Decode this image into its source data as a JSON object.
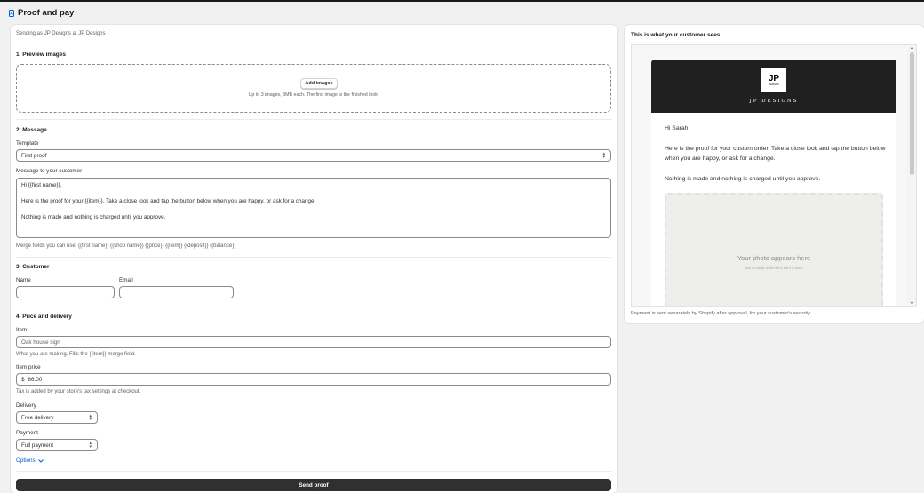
{
  "page": {
    "title": "Proof and pay"
  },
  "sender": {
    "text": "Sending as JP Designs at JP Designs"
  },
  "preview_images": {
    "heading": "1. Preview images",
    "add_label": "Add images",
    "help": "Up to 3 images, 8MB each. The first image is the finished look."
  },
  "message": {
    "heading": "2. Message",
    "template_label": "Template",
    "template_value": "First proof",
    "message_label": "Message to your customer",
    "lines": [
      "Hi {{first name}},",
      "Here is the proof for your {{item}}. Take a close look and tap the button below when you are happy, or ask for a change.",
      "Nothing is made and nothing is charged until you approve."
    ],
    "merge_help": "Merge fields you can use: {{first name}} {{shop name}} {{price}} {{item}} {{deposit}} {{balance}}"
  },
  "customer": {
    "heading": "3. Customer",
    "name_label": "Name",
    "name_value": "",
    "email_label": "Email",
    "email_value": ""
  },
  "price": {
    "heading": "4. Price and delivery",
    "item_label": "Item",
    "item_placeholder": "Oak house sign",
    "item_help": "What you are making. Fills the {{item}} merge field.",
    "price_label": "Item price",
    "currency": "$",
    "price_value": "86.00",
    "price_help": "Tax is added by your store's tax settings at checkout.",
    "delivery_label": "Delivery",
    "delivery_value": "Free delivery",
    "payment_label": "Payment",
    "payment_value": "Full payment",
    "options_label": "Options",
    "send_label": "Send proof"
  },
  "preview": {
    "heading": "This is what your customer sees",
    "logo_text": "JP",
    "logo_sub": "DESIGNS",
    "brand": "JP DESIGNS",
    "greeting": "Hi Sarah,",
    "body1": "Here is the proof for your custom order. Take a close look and tap the button below when you are happy, or ask for a change.",
    "body2": "Nothing is made and nothing is charged until you approve.",
    "photo_title": "Your photo appears here",
    "photo_sub": "Add an image on the left to see it in place",
    "footer": "Payment is sent separately by Shopify after approval, for your customer's security."
  },
  "colors": {
    "accent": "#005bd3",
    "primary_button": "#303030",
    "email_header": "#202020"
  },
  "icons": {
    "title": "proof-icon",
    "select": "chevron-up-down-icon",
    "options": "chevron-down-icon"
  }
}
